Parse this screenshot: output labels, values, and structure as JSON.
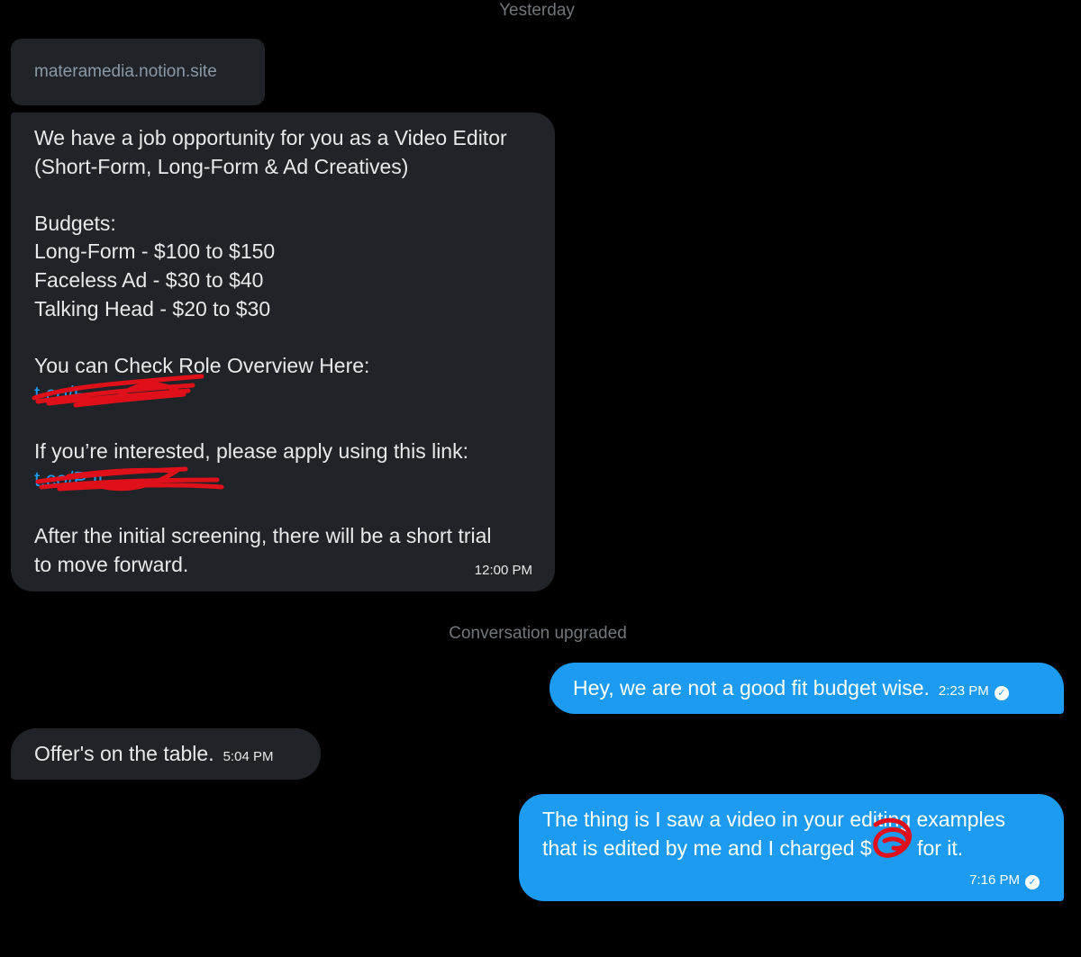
{
  "header": {
    "date_separator": "Yesterday"
  },
  "link_preview": {
    "domain": "materamedia.notion.site"
  },
  "messages": [
    {
      "direction": "incoming",
      "lines": [
        "We have a job opportunity for you as a Video Editor",
        "(Short-Form, Long-Form & Ad Creatives)",
        "",
        "Budgets:",
        "Long-Form - $100 to $150",
        "Faceless Ad - $30 to $40",
        "Talking Head - $20 to $30",
        "",
        "You can Check Role Overview Here:",
        "t.co/F",
        "",
        "If you’re interested, please apply using this link:",
        "t.co/PJI",
        "",
        "After the initial screening, there will be a short trial",
        "to move forward."
      ],
      "time": "12:00 PM"
    },
    {
      "direction": "outgoing",
      "text": "Hey, we are not a good fit budget wise.",
      "time": "2:23 PM",
      "status_icon": "read-check-icon"
    },
    {
      "direction": "incoming",
      "text": "Offer's on the table.",
      "time": "5:04 PM"
    },
    {
      "direction": "outgoing",
      "line1": "The thing is I saw a video in your editing examples",
      "line2_before": "that is edited by me and I charged $",
      "line2_after": " for it.",
      "time": "7:16 PM",
      "status_icon": "read-check-icon"
    }
  ],
  "system_note": "Conversation upgraded",
  "colors": {
    "background": "#000000",
    "incoming_bubble": "#202327",
    "outgoing_bubble": "#1d9bf0",
    "link": "#1d9bf0",
    "muted_text": "#71767b",
    "redaction": "#e0101a"
  }
}
